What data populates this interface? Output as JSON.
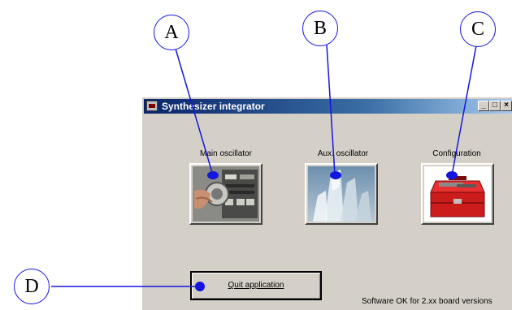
{
  "window": {
    "title": "Synthesizer integrator",
    "controls": {
      "minimize": "_",
      "maximize": "□",
      "close": "×"
    }
  },
  "buttons": {
    "main_oscillator": {
      "label": "Main oscillator",
      "icon": "oscillator-dial-icon"
    },
    "aux_oscillator": {
      "label": "Aux. oscillator",
      "icon": "crystal-icon"
    },
    "configuration": {
      "label": "Configuration",
      "icon": "toolbox-icon"
    },
    "quit": {
      "label": "Quit application"
    }
  },
  "status_text": "Software OK for  2.xx board versions",
  "callouts": {
    "a": "A",
    "b": "B",
    "c": "C",
    "d": "D"
  },
  "colors": {
    "callout_line": "#1515e0",
    "window_bg": "#d4d0c8",
    "titlebar": "#0a246a"
  }
}
